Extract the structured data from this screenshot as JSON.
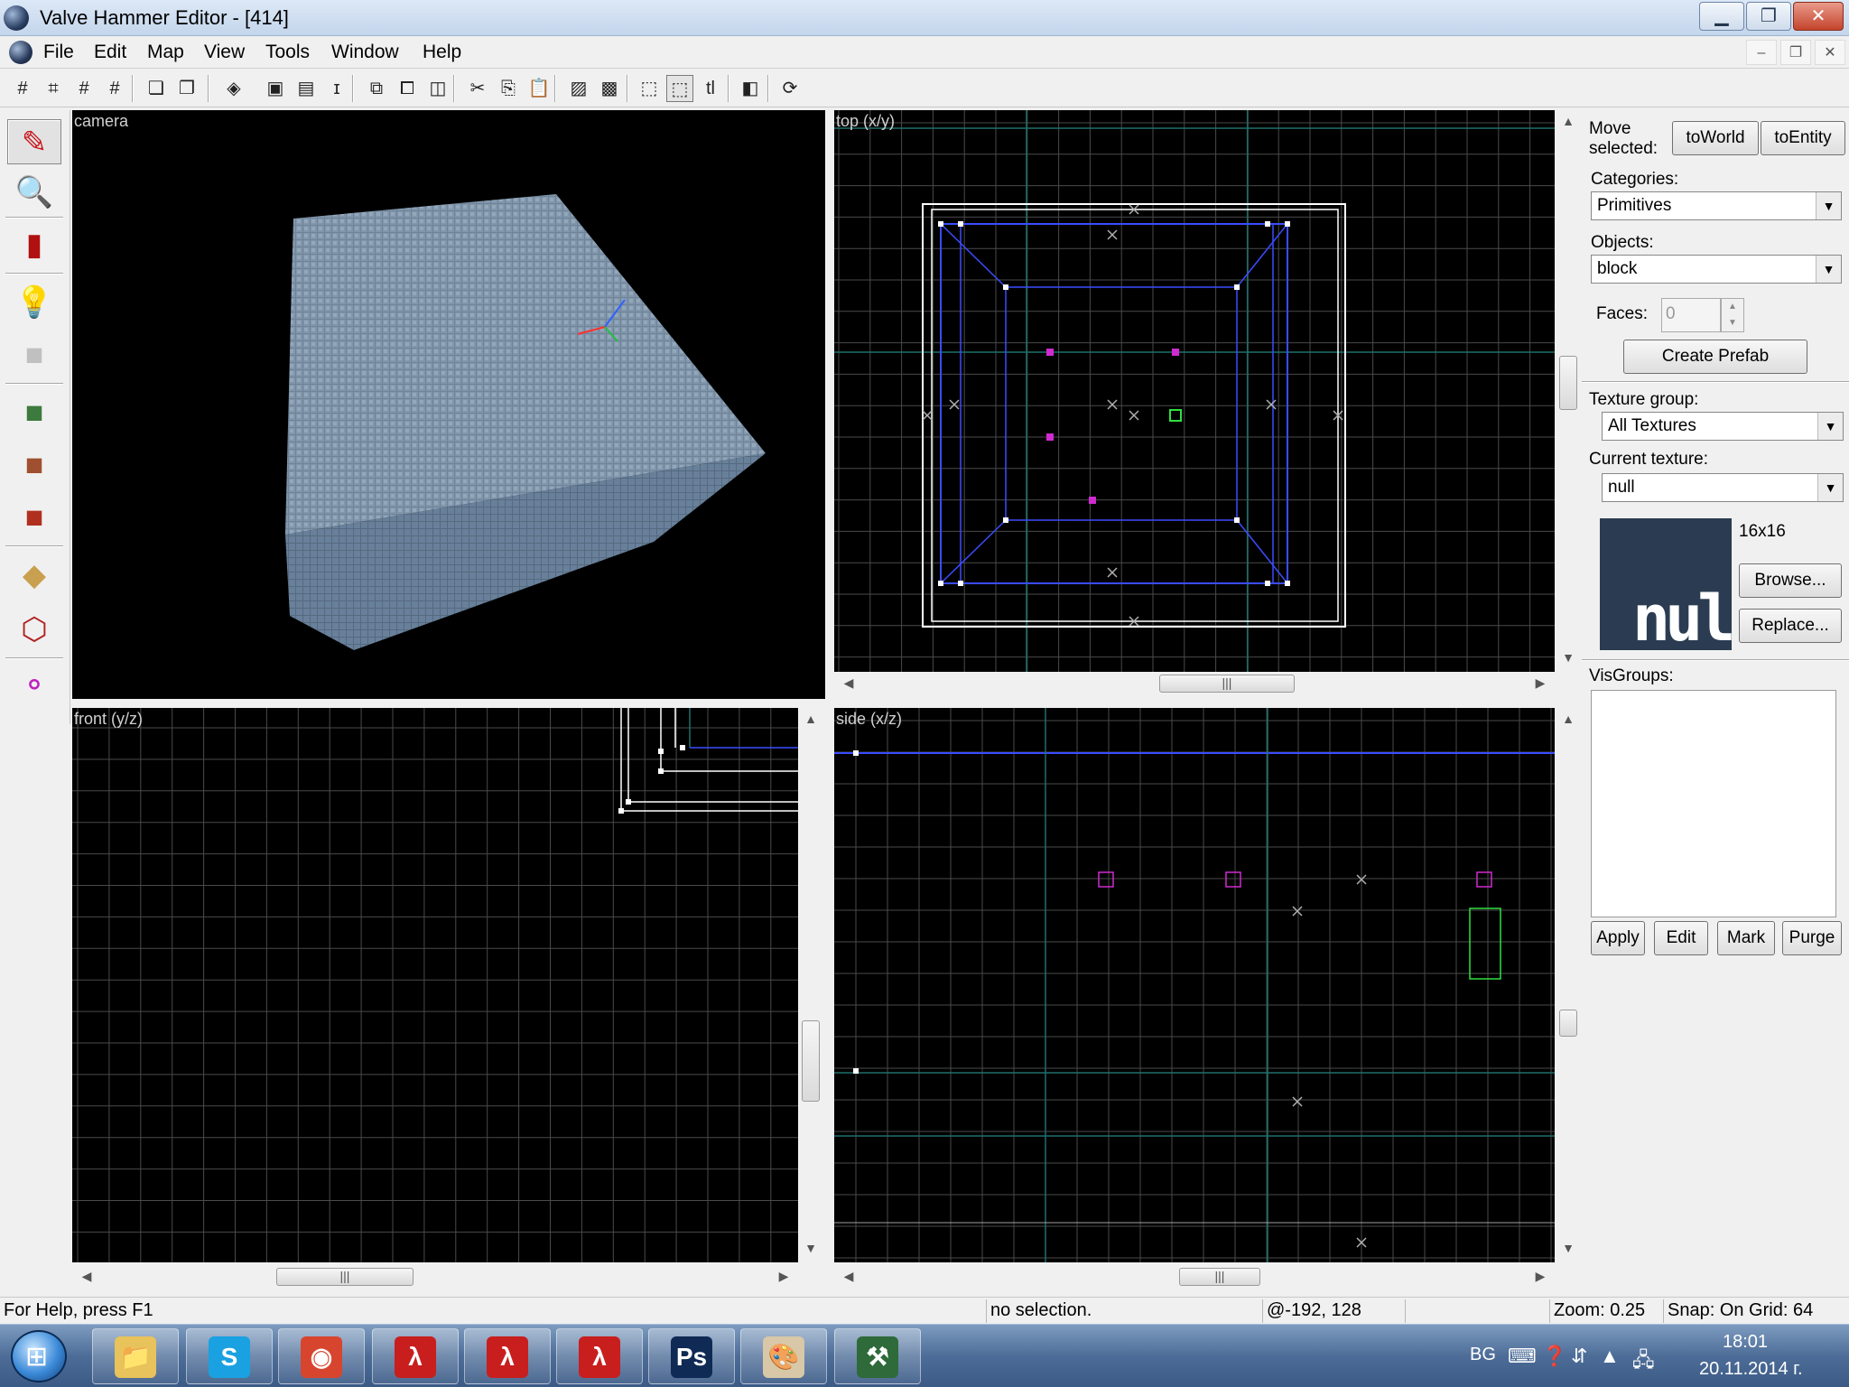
{
  "window": {
    "title": "Valve Hammer Editor - [414]",
    "minimize": "▁",
    "maximize": "❐",
    "close": "✕"
  },
  "menu": {
    "items": [
      "File",
      "Edit",
      "Map",
      "View",
      "Tools",
      "Window",
      "Help"
    ],
    "mdi_minimize": "–",
    "mdi_restore": "❐",
    "mdi_close": "✕"
  },
  "toolbar": {
    "buttons": [
      {
        "icon": "grid-toggle-icon",
        "glyph": "#"
      },
      {
        "icon": "grid-snap-icon",
        "glyph": "⌗"
      },
      {
        "icon": "grid-smaller-icon",
        "glyph": "#"
      },
      {
        "icon": "grid-larger-icon",
        "glyph": "#"
      },
      {
        "icon": "group-icon",
        "glyph": "❏"
      },
      {
        "icon": "ungroup-icon",
        "glyph": "❐"
      },
      {
        "icon": "tie-to-entity-icon",
        "glyph": "◈"
      },
      {
        "icon": "hide-selected-icon",
        "glyph": "▣"
      },
      {
        "icon": "hide-unselected-icon",
        "glyph": "▤"
      },
      {
        "icon": "texture-lock-icon",
        "glyph": "ɪ"
      },
      {
        "icon": "carve-icon",
        "glyph": "⧉"
      },
      {
        "icon": "hollow-icon",
        "glyph": "⧠"
      },
      {
        "icon": "clipping-icon",
        "glyph": "◫"
      },
      {
        "icon": "cut-icon",
        "glyph": "✂"
      },
      {
        "icon": "copy-icon",
        "glyph": "⎘"
      },
      {
        "icon": "paste-icon",
        "glyph": "📋"
      },
      {
        "icon": "toggle-helpers-icon",
        "glyph": "▨"
      },
      {
        "icon": "toggle-decals-icon",
        "glyph": "▩"
      },
      {
        "icon": "select-objects-icon",
        "glyph": "⬚"
      },
      {
        "icon": "select-by-handles-icon",
        "glyph": "⬚"
      },
      {
        "icon": "text-tl-icon",
        "glyph": "tl"
      },
      {
        "icon": "run-map-icon",
        "glyph": "◧"
      },
      {
        "icon": "compile-icon",
        "glyph": "⟳"
      }
    ]
  },
  "tools": [
    {
      "icon": "selection-tool-icon",
      "glyph": "✎",
      "color": "#c8141a"
    },
    {
      "icon": "magnify-tool-icon",
      "glyph": "🔍",
      "color": "#c8141a"
    },
    {
      "icon": "camera-tool-icon",
      "glyph": "▮",
      "color": "#b01010"
    },
    {
      "icon": "entity-tool-icon",
      "glyph": "💡",
      "color": "#c8c8a0"
    },
    {
      "icon": "block-tool-icon",
      "glyph": "■",
      "color": "#c0c0c0"
    },
    {
      "icon": "texture-application-icon",
      "glyph": "■",
      "color": "#3d7a3d"
    },
    {
      "icon": "apply-current-texture-icon",
      "glyph": "■",
      "color": "#a05030"
    },
    {
      "icon": "decal-tool-icon",
      "glyph": "■",
      "color": "#b03020"
    },
    {
      "icon": "clipping-tool-icon",
      "glyph": "◆",
      "color": "#c8a050"
    },
    {
      "icon": "vertex-manipulation-icon",
      "glyph": "⬡",
      "color": "#b02020"
    },
    {
      "icon": "path-tool-icon",
      "glyph": "⚬",
      "color": "#c020c0"
    }
  ],
  "viewports": {
    "camera_label": "camera",
    "top_label": "top (x/y)",
    "front_label": "front (y/z)",
    "side_label": "side (x/z)"
  },
  "panel": {
    "move_selected": "Move selected:",
    "to_world": "toWorld",
    "to_entity": "toEntity",
    "categories_label": "Categories:",
    "categories_value": "Primitives",
    "objects_label": "Objects:",
    "objects_value": "block",
    "faces_label": "Faces:",
    "faces_value": "0",
    "create_prefab": "Create Prefab",
    "texture_group_label": "Texture group:",
    "texture_group_value": "All Textures",
    "current_texture_label": "Current texture:",
    "current_texture_value": "null",
    "texture_size": "16x16",
    "texture_preview_text": "null",
    "browse": "Browse...",
    "replace": "Replace...",
    "visgroups_label": "VisGroups:",
    "apply": "Apply",
    "edit": "Edit",
    "mark": "Mark",
    "purge": "Purge"
  },
  "status": {
    "help": "For Help, press F1",
    "selection": "no selection.",
    "coords": "@-192, 128",
    "zoom": "Zoom: 0.25",
    "snap": "Snap: On Grid: 64"
  },
  "taskbar": {
    "apps": [
      {
        "icon": "explorer-icon",
        "glyph": "📁",
        "bg": "#e8c25a"
      },
      {
        "icon": "skype-icon",
        "glyph": "S",
        "bg": "#1aa1e1"
      },
      {
        "icon": "chrome-icon",
        "glyph": "◉",
        "bg": "#d8452e"
      },
      {
        "icon": "half-life-icon",
        "glyph": "λ",
        "bg": "#c81e1e"
      },
      {
        "icon": "half-life-icon",
        "glyph": "λ",
        "bg": "#c81e1e"
      },
      {
        "icon": "half-life-icon",
        "glyph": "λ",
        "bg": "#c81e1e"
      },
      {
        "icon": "photoshop-icon",
        "glyph": "Ps",
        "bg": "#0f2a54"
      },
      {
        "icon": "paint-icon",
        "glyph": "🎨",
        "bg": "#d8c8a8"
      },
      {
        "icon": "hammer-icon",
        "glyph": "⚒",
        "bg": "#2e6a3a"
      }
    ],
    "language": "BG",
    "time": "18:01",
    "date": "20.11.2014 г."
  }
}
